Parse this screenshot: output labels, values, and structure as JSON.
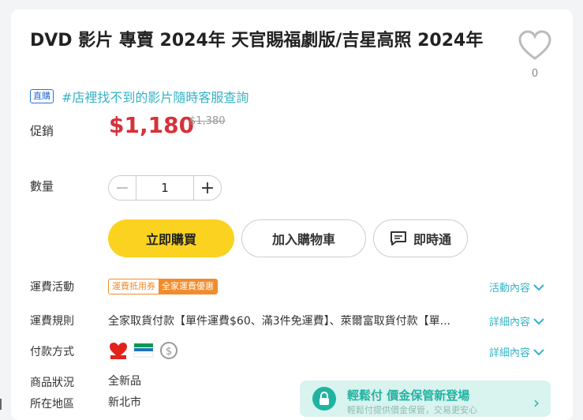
{
  "product": {
    "title": "DVD 影片 專賣 2024年 天官賜福劇版/吉星高照 2024年",
    "favorite_count": "0",
    "badge": "直購",
    "promo_text": "#店裡找不到的影片隨時客服查詢"
  },
  "price": {
    "label": "促銷",
    "current": "$1,180",
    "original": "$1,380"
  },
  "quantity": {
    "label": "數量",
    "minus": "−",
    "value": "1",
    "plus": "+"
  },
  "actions": {
    "buy_now": "立即購買",
    "add_to_cart": "加入購物車",
    "chat": "即時通"
  },
  "details": {
    "shipping_promo": {
      "label": "運費活動",
      "coupon_a": "運費抵用券",
      "coupon_b": "全家運費優惠",
      "link": "活動內容"
    },
    "shipping_rules": {
      "label": "運費規則",
      "value": "全家取貨付款【單件運費$60、滿3件免運費】、萊爾富取貨付款【單...",
      "link": "詳細內容"
    },
    "payment": {
      "label": "付款方式",
      "icons": [
        "hilife-icon",
        "familymart-icon",
        "dollar-icon"
      ],
      "link": "詳細內容"
    },
    "condition": {
      "label": "商品狀況",
      "value": "全新品"
    },
    "location": {
      "label": "所在地區",
      "value": "新北市"
    }
  },
  "floating_banner": {
    "title": "輕鬆付 價金保管新登場",
    "subtitle": "輕鬆付提供價金保管，交易更安心"
  },
  "colors": {
    "accent_yellow": "#fbd220",
    "price_red": "#d6313a",
    "link_teal": "#35b3c7",
    "coupon_orange": "#f08c2c"
  }
}
